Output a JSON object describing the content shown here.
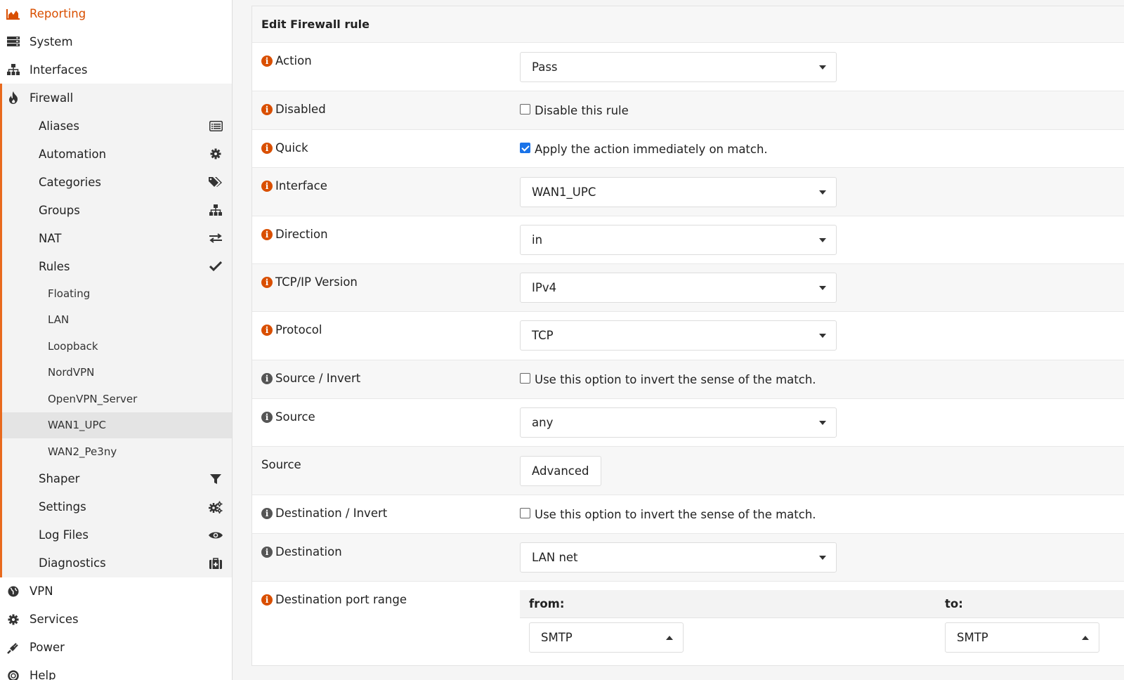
{
  "sidebar": {
    "top_items": [
      {
        "label": "Reporting",
        "icon": "area-chart-icon"
      },
      {
        "label": "System",
        "icon": "server-icon"
      },
      {
        "label": "Interfaces",
        "icon": "sitemap-icon"
      },
      {
        "label": "Firewall",
        "icon": "fire-icon"
      }
    ],
    "firewall_items": [
      {
        "label": "Aliases",
        "icon": "list-alt-icon"
      },
      {
        "label": "Automation",
        "icon": "cog-icon"
      },
      {
        "label": "Categories",
        "icon": "tags-icon"
      },
      {
        "label": "Groups",
        "icon": "sitemap-icon"
      },
      {
        "label": "NAT",
        "icon": "exchange-icon"
      },
      {
        "label": "Rules",
        "icon": "check-icon"
      }
    ],
    "rules_items": [
      "Floating",
      "LAN",
      "Loopback",
      "NordVPN",
      "OpenVPN_Server",
      "WAN1_UPC",
      "WAN2_Pe3ny"
    ],
    "active_rule_interface": "WAN1_UPC",
    "firewall_items_after": [
      {
        "label": "Shaper",
        "icon": "filter-icon"
      },
      {
        "label": "Settings",
        "icon": "cogs-icon"
      },
      {
        "label": "Log Files",
        "icon": "eye-icon"
      },
      {
        "label": "Diagnostics",
        "icon": "medkit-icon"
      }
    ],
    "bottom_items": [
      {
        "label": "VPN",
        "icon": "globe-icon"
      },
      {
        "label": "Services",
        "icon": "cog-icon"
      },
      {
        "label": "Power",
        "icon": "plug-icon"
      },
      {
        "label": "Help",
        "icon": "life-ring-icon"
      }
    ]
  },
  "form": {
    "title": "Edit Firewall rule",
    "action": {
      "label": "Action",
      "value": "Pass"
    },
    "disabled": {
      "label": "Disabled",
      "checkbox_label": "Disable this rule",
      "checked": false
    },
    "quick": {
      "label": "Quick",
      "checkbox_label": "Apply the action immediately on match.",
      "checked": true
    },
    "interface": {
      "label": "Interface",
      "value": "WAN1_UPC"
    },
    "direction": {
      "label": "Direction",
      "value": "in"
    },
    "ipversion": {
      "label": "TCP/IP Version",
      "value": "IPv4"
    },
    "protocol": {
      "label": "Protocol",
      "value": "TCP"
    },
    "source_invert": {
      "label": "Source / Invert",
      "checkbox_label": "Use this option to invert the sense of the match.",
      "checked": false
    },
    "source": {
      "label": "Source",
      "value": "any"
    },
    "source_advanced": {
      "label": "Source",
      "button": "Advanced"
    },
    "destination_invert": {
      "label": "Destination / Invert",
      "checkbox_label": "Use this option to invert the sense of the match.",
      "checked": false
    },
    "destination": {
      "label": "Destination",
      "value": "LAN net"
    },
    "dest_port_range": {
      "label": "Destination port range",
      "from_label": "from:",
      "to_label": "to:",
      "from_value": "SMTP",
      "to_value": "SMTP"
    }
  },
  "colors": {
    "accent": "#d94f00",
    "sidebar_bar": "#e8691d",
    "checkbox_checked": "#1a73e8"
  }
}
